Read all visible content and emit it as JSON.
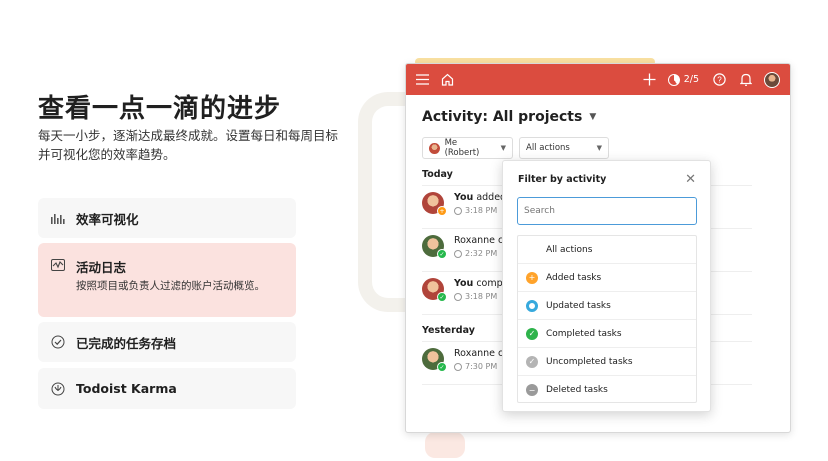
{
  "hero": {
    "title": "查看一点一滴的进步",
    "subtitle": "每天一小步，逐渐达成最终成就。设置每日和每周目标并可视化您的效率趋势。"
  },
  "features": [
    {
      "title": "效率可视化",
      "icon": "bar-chart-icon"
    },
    {
      "title": "活动日志",
      "desc": "按照项目或负责人过滤的账户活动概览。",
      "icon": "activity-icon"
    },
    {
      "title": "已完成的任务存档",
      "icon": "check-circle-icon"
    },
    {
      "title": "Todoist Karma",
      "icon": "karma-icon"
    }
  ],
  "app": {
    "topbar": {
      "karma": "2/5"
    },
    "title": "Activity: All projects",
    "filters": {
      "person": "Me (Robert)",
      "action": "All actions"
    },
    "sections": [
      {
        "label": "Today",
        "items": [
          {
            "actor": "You",
            "text": " added",
            "time": "3:18 PM"
          },
          {
            "actor": "",
            "text": "Roxanne c",
            "time": "2:32 PM"
          },
          {
            "actor": "You",
            "text": " comp",
            "time": "3:18 PM"
          }
        ]
      },
      {
        "label": "Yesterday",
        "items": [
          {
            "actor": "",
            "text": "Roxanne c",
            "time": "7:30 PM"
          }
        ]
      }
    ]
  },
  "dropdown": {
    "title": "Filter by activity",
    "search_placeholder": "Search",
    "options": [
      "All actions",
      "Added tasks",
      "Updated tasks",
      "Completed tasks",
      "Uncompleted tasks",
      "Deleted tasks"
    ]
  },
  "colors": {
    "brand": "#db4c3f",
    "highlight": "#fbe2df"
  }
}
